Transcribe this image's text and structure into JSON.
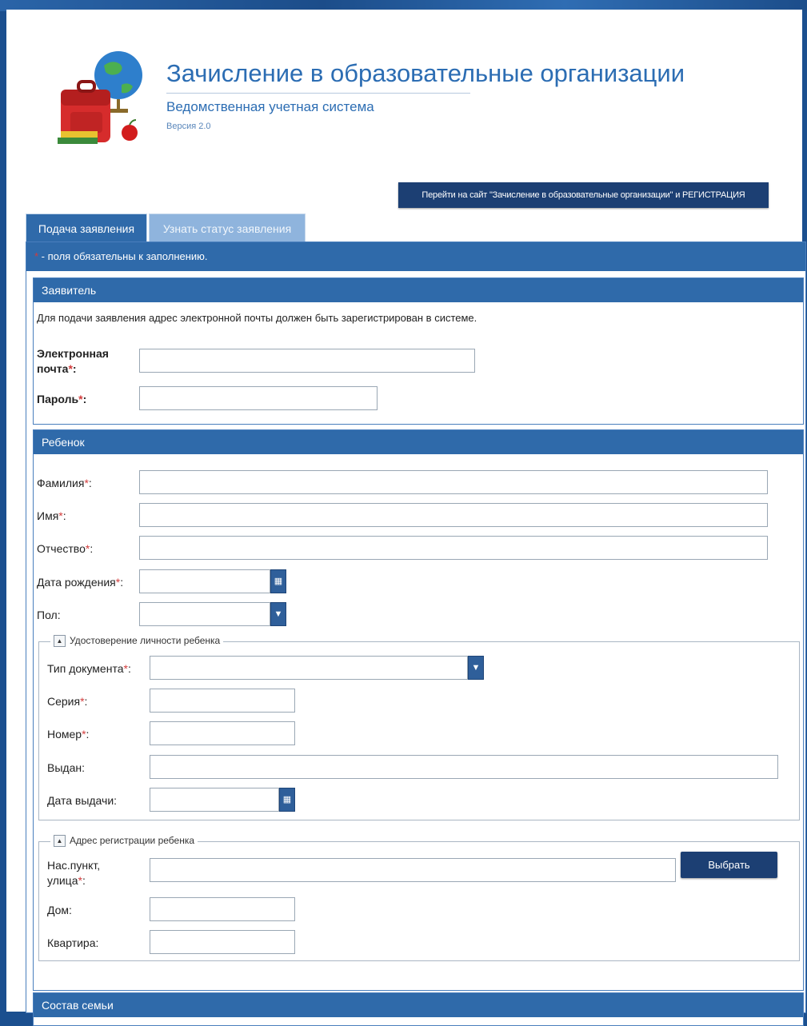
{
  "header": {
    "title": "Зачисление в образовательные организации",
    "subtitle": "Ведомственная учетная система",
    "version": "Версия 2.0",
    "site_link": "Перейти на сайт \"Зачисление в образовательные организации\" и РЕГИСТРАЦИЯ"
  },
  "tabs": [
    {
      "label": "Подача заявления",
      "active": true
    },
    {
      "label": "Узнать статус заявления",
      "active": false
    }
  ],
  "required_note": {
    "asterisk": "*",
    "text": " - поля обязательны к заполнению."
  },
  "applicant": {
    "title": "Заявитель",
    "note": "Для подачи заявления адрес электронной почты должен быть зарегистрирован в системе.",
    "email_label_1": "Электронная",
    "email_label_2": "почта",
    "password_label": "Пароль",
    "email_value": "",
    "password_value": ""
  },
  "child": {
    "title": "Ребенок",
    "surname_label": "Фамилия",
    "name_label": "Имя",
    "patronymic_label": "Отчество",
    "birthdate_label": "Дата рождения",
    "gender_label": "Пол:",
    "surname_value": "",
    "name_value": "",
    "patronymic_value": "",
    "birthdate_value": "",
    "gender_value": ""
  },
  "identity_doc": {
    "legend": "Удостоверение личности ребенка",
    "doc_type_label": "Тип документа",
    "series_label": "Серия",
    "number_label": "Номер",
    "issued_by_label": "Выдан:",
    "issue_date_label": "Дата выдачи:",
    "doc_type_value": "",
    "series_value": "",
    "number_value": "",
    "issued_by_value": "",
    "issue_date_value": ""
  },
  "address": {
    "legend": "Адрес регистрации ребенка",
    "locality_label_1": "Нас.пункт,",
    "locality_label_2": "улица",
    "house_label": "Дом:",
    "apartment_label": "Квартира:",
    "choose_button": "Выбрать",
    "locality_value": "",
    "house_value": "",
    "apartment_value": ""
  },
  "family": {
    "title": "Состав семьи"
  },
  "icons": {
    "calendar": "calendar-icon",
    "dropdown": "chevron-down-icon",
    "collapse": "chevron-up-icon",
    "logo": "school-backpack-globe-logo"
  },
  "colors": {
    "header_bar": "#2f6aaa",
    "dark_button": "#1c3f73",
    "title_blue": "#2c6db3",
    "required_red": "#d23c3c",
    "background": "#1b4f8f"
  }
}
